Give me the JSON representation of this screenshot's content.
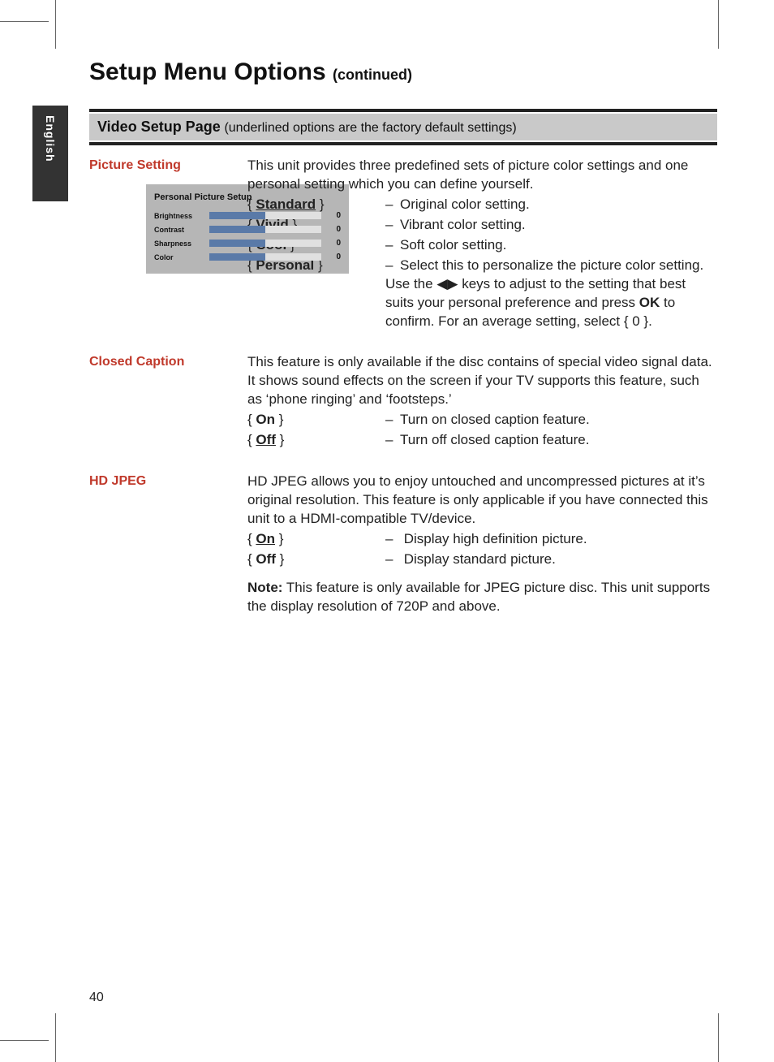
{
  "page_number": "40",
  "language_tab": "English",
  "title_main": "Setup Menu Options",
  "title_cont": "(continued)",
  "section_header_bold": "Video Setup Page",
  "section_header_paren": "(underlined options are the factory default settings)",
  "picture_setting": {
    "label": "Picture Setting",
    "intro": "This unit provides three predefined sets of picture color settings and one personal setting which you can define yourself.",
    "options": [
      {
        "name": "Standard",
        "default": true,
        "desc": "Original color setting."
      },
      {
        "name": "Vivid",
        "default": false,
        "desc": "Vibrant color setting."
      },
      {
        "name": "Cool",
        "default": false,
        "desc": "Soft color setting."
      },
      {
        "name": "Personal",
        "default": false,
        "desc_pre": "Select this to personalize the picture color setting. Use the ",
        "desc_mid": " keys to adjust to the setting that best suits your personal preference and press ",
        "desc_ok": "OK",
        "desc_post": " to confirm. For an average setting, select { 0 }."
      }
    ],
    "personal_box": {
      "title": "Personal Picture Setup",
      "rows": [
        {
          "label": "Brightness",
          "value": "0"
        },
        {
          "label": "Contrast",
          "value": "0"
        },
        {
          "label": "Sharpness",
          "value": "0"
        },
        {
          "label": "Color",
          "value": "0"
        }
      ]
    }
  },
  "closed_caption": {
    "label": "Closed Caption",
    "intro": "This feature is only available if the disc contains of special video signal data. It shows sound effects on the screen if your TV supports this feature, such as ‘phone ringing’ and ‘footsteps.’",
    "options": [
      {
        "name": "On",
        "default": false,
        "desc": "Turn on closed caption feature."
      },
      {
        "name": "Off",
        "default": true,
        "desc": "Turn off closed caption feature."
      }
    ]
  },
  "hd_jpeg": {
    "label": "HD JPEG",
    "intro": "HD JPEG allows you to enjoy untouched and uncompressed pictures at it’s original resolution. This feature is only applicable if you have connected this unit to a HDMI-compatible TV/device.",
    "options": [
      {
        "name": "On",
        "default": true,
        "desc": "Display high definition picture."
      },
      {
        "name": "Off",
        "default": false,
        "desc": "Display standard picture."
      }
    ],
    "note_label": "Note:",
    "note_text": " This feature is only available for JPEG picture disc. This unit supports the display resolution of 720P and above."
  }
}
